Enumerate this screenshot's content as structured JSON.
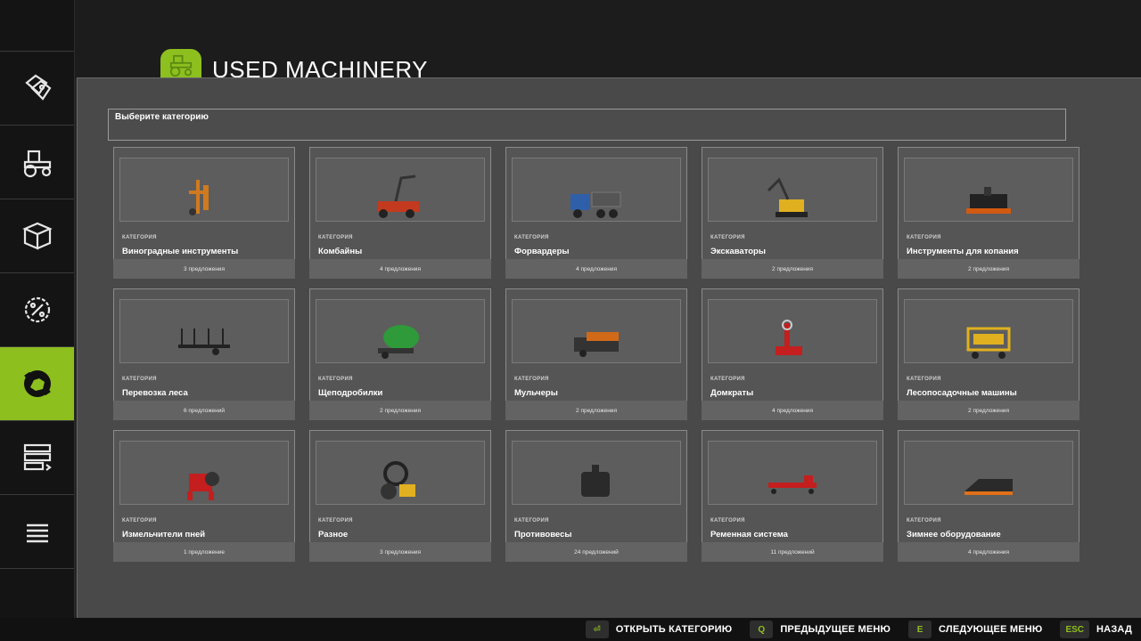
{
  "header": {
    "title": "USED MACHINERY",
    "icon": "tractor-icon"
  },
  "sidebar": {
    "items": [
      {
        "icon": "price-tags-icon",
        "active": false
      },
      {
        "icon": "tractor-icon",
        "active": false
      },
      {
        "icon": "box-icon",
        "active": false
      },
      {
        "icon": "percent-gear-icon",
        "active": false
      },
      {
        "icon": "used-machinery-icon",
        "active": true
      },
      {
        "icon": "list-transfer-icon",
        "active": false
      },
      {
        "icon": "menu-icon",
        "active": false
      }
    ]
  },
  "selector": {
    "label": "Выберите категорию"
  },
  "cards": [
    {
      "kicker": "КАТЕГОРИЯ",
      "name": "Виноградные инструменты",
      "offers": "3 предложения",
      "icon": "vineyard-tool-icon",
      "color": "#d07a20"
    },
    {
      "kicker": "КАТЕГОРИЯ",
      "name": "Комбайны",
      "offers": "4 предложения",
      "icon": "harvester-icon",
      "color": "#c43a1e"
    },
    {
      "kicker": "КАТЕГОРИЯ",
      "name": "Форвардеры",
      "offers": "4 предложения",
      "icon": "forwarder-icon",
      "color": "#2f5fa8"
    },
    {
      "kicker": "КАТЕГОРИЯ",
      "name": "Экскаваторы",
      "offers": "2 предложения",
      "icon": "excavator-icon",
      "color": "#e0b020"
    },
    {
      "kicker": "КАТЕГОРИЯ",
      "name": "Инструменты для копания",
      "offers": "2 предложения",
      "icon": "digging-tool-icon",
      "color": "#d05a10"
    },
    {
      "kicker": "КАТЕГОРИЯ",
      "name": "Перевозка леса",
      "offers": "6 предложений",
      "icon": "timber-trailer-icon",
      "color": "#222222"
    },
    {
      "kicker": "КАТЕГОРИЯ",
      "name": "Щеподробилки",
      "offers": "2 предложения",
      "icon": "wood-chipper-icon",
      "color": "#2f9a3a"
    },
    {
      "kicker": "КАТЕГОРИЯ",
      "name": "Мульчеры",
      "offers": "2 предложения",
      "icon": "mulcher-icon",
      "color": "#d06a18"
    },
    {
      "kicker": "КАТЕГОРИЯ",
      "name": "Домкраты",
      "offers": "4 предложения",
      "icon": "stump-jack-icon",
      "color": "#c41e1e"
    },
    {
      "kicker": "КАТЕГОРИЯ",
      "name": "Лесопосадочные машины",
      "offers": "2 предложения",
      "icon": "tree-planter-icon",
      "color": "#e0b020"
    },
    {
      "kicker": "КАТЕГОРИЯ",
      "name": "Измельчители пней",
      "offers": "1 предложение",
      "icon": "stump-cutter-icon",
      "color": "#c41e1e"
    },
    {
      "kicker": "КАТЕГОРИЯ",
      "name": "Разное",
      "offers": "3 предложения",
      "icon": "misc-machine-icon",
      "color": "#e0b020"
    },
    {
      "kicker": "КАТЕГОРИЯ",
      "name": "Противовесы",
      "offers": "24 предложений",
      "icon": "counterweight-icon",
      "color": "#222222"
    },
    {
      "kicker": "КАТЕГОРИЯ",
      "name": "Ременная система",
      "offers": "11 предложений",
      "icon": "belt-system-icon",
      "color": "#c41e1e"
    },
    {
      "kicker": "КАТЕГОРИЯ",
      "name": "Зимнее оборудование",
      "offers": "4 предложения",
      "icon": "snow-plow-icon",
      "color": "#e07018"
    }
  ],
  "bottombar": {
    "hints": [
      {
        "key": "⏎",
        "label": "ОТКРЫТЬ КАТЕГОРИЮ"
      },
      {
        "key": "Q",
        "label": "ПРЕДЫДУЩЕЕ МЕНЮ"
      },
      {
        "key": "E",
        "label": "СЛЕДУЮЩЕЕ МЕНЮ"
      },
      {
        "key": "ESC",
        "label": "НАЗАД"
      }
    ]
  },
  "colors": {
    "accent": "#8dbf1f",
    "panel": "#494949",
    "card": "#555555"
  }
}
